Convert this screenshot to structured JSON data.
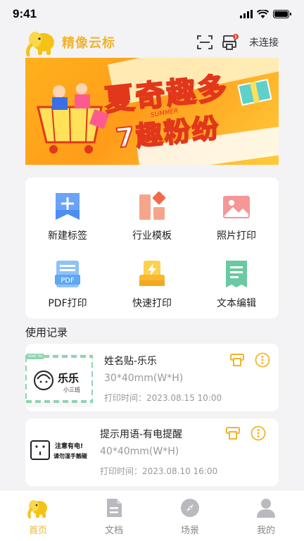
{
  "status_bar": {
    "time": "9:41"
  },
  "header": {
    "brand": "精像云标",
    "connection_status": "未连接"
  },
  "banner": {
    "line1": "夏奇趣多",
    "line2": "7趣粉纷",
    "tag": "SUMMER"
  },
  "functions": [
    {
      "label": "新建标签",
      "icon": "new-label-icon"
    },
    {
      "label": "行业模板",
      "icon": "template-icon"
    },
    {
      "label": "照片打印",
      "icon": "photo-print-icon"
    },
    {
      "label": "PDF打印",
      "icon": "pdf-print-icon"
    },
    {
      "label": "快速打印",
      "icon": "quick-print-icon"
    },
    {
      "label": "文本编辑",
      "icon": "text-edit-icon"
    }
  ],
  "records_title": "使用记录",
  "records": [
    {
      "title": "姓名贴-乐乐",
      "size": "30*40mm(W*H)",
      "time": "打印时间：2023.08.15 10:00",
      "thumb_text": "乐乐",
      "thumb_sub": "小三班",
      "thumb_tag": "NAME TAG"
    },
    {
      "title": "提示用语-有电提醒",
      "size": "40*40mm(W*H)",
      "time": "打印时间：2023.08.10 16:00",
      "thumb_line1": "注意有电!",
      "thumb_line2": "请勿湿手触碰"
    }
  ],
  "tabs": [
    {
      "label": "首页",
      "icon": "elephant-home-icon",
      "active": true
    },
    {
      "label": "文档",
      "icon": "document-icon",
      "active": false
    },
    {
      "label": "场景",
      "icon": "compass-icon",
      "active": false
    },
    {
      "label": "我的",
      "icon": "person-icon",
      "active": false
    }
  ],
  "colors": {
    "accent": "#f0b52c",
    "background": "#f3f3f5"
  }
}
